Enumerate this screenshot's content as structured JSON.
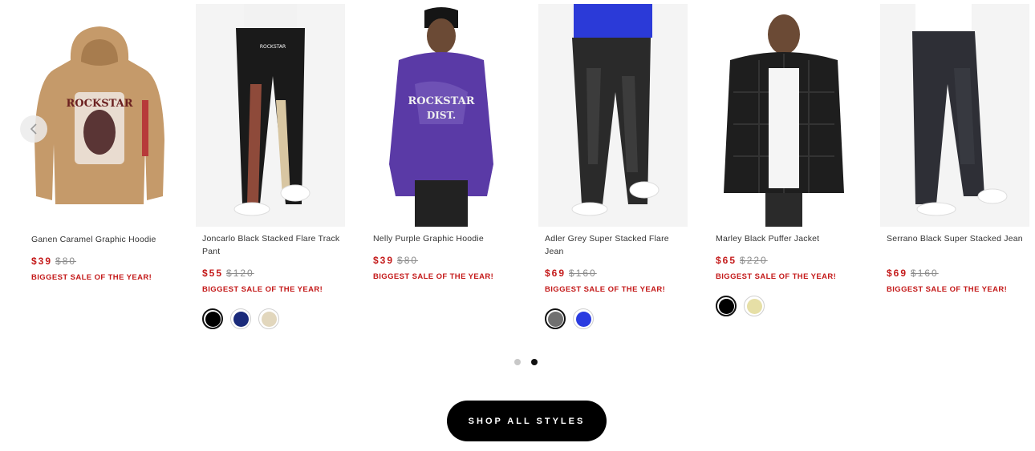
{
  "products": [
    {
      "title": "Ganen Caramel Graphic Hoodie",
      "price": "$39",
      "compare_price": "$80",
      "promo": "BIGGEST SALE OF THE YEAR!",
      "image": "caramel-graphic-hoodie",
      "swatches": []
    },
    {
      "title": "Joncarlo Black Stacked Flare Track Pant",
      "price": "$55",
      "compare_price": "$120",
      "promo": "BIGGEST SALE OF THE YEAR!",
      "image": "black-track-pant",
      "swatches": [
        "#000000",
        "#1a2a7a",
        "#e2d7bd"
      ]
    },
    {
      "title": "Nelly Purple Graphic Hoodie",
      "price": "$39",
      "compare_price": "$80",
      "promo": "BIGGEST SALE OF THE YEAR!",
      "image": "purple-graphic-hoodie",
      "swatches": []
    },
    {
      "title": "Adler Grey Super Stacked Flare Jean",
      "price": "$69",
      "compare_price": "$160",
      "promo": "BIGGEST SALE OF THE YEAR!",
      "image": "grey-stacked-jean",
      "swatches": [
        "#707070",
        "#2a3be0"
      ]
    },
    {
      "title": "Marley Black Puffer Jacket",
      "price": "$65",
      "compare_price": "$220",
      "promo": "BIGGEST SALE OF THE YEAR!",
      "image": "black-puffer-jacket",
      "swatches": [
        "#000000",
        "#e6dfa6"
      ]
    },
    {
      "title": "Serrano Black Super Stacked Jean",
      "price": "$69",
      "compare_price": "$160",
      "promo": "BIGGEST SALE OF THE YEAR!",
      "image": "black-stacked-jean",
      "swatches": []
    }
  ],
  "carousel": {
    "prev_icon": "chevron-left-icon",
    "active_page": 2,
    "page_count": 2
  },
  "cta": {
    "label": "SHOP ALL STYLES"
  },
  "colors": {
    "sale_red": "#c41a1a",
    "button_bg": "#000000"
  }
}
